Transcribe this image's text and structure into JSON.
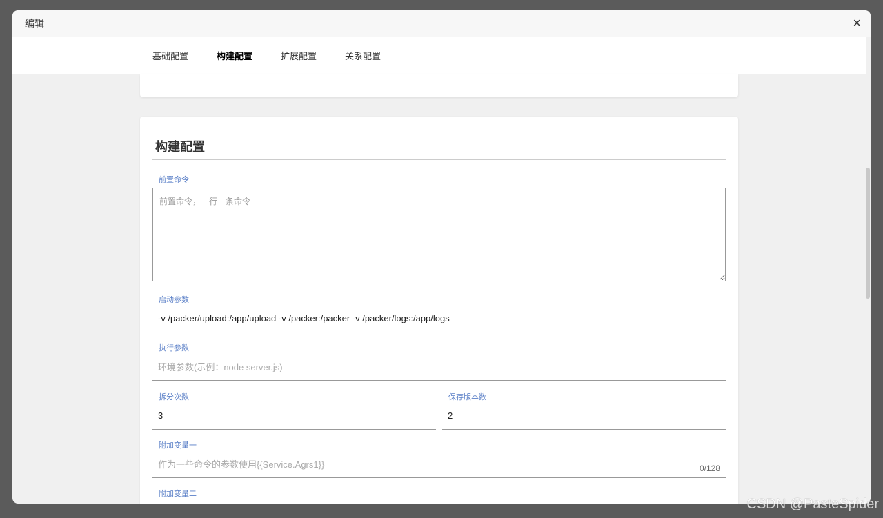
{
  "dialog": {
    "title": "编辑",
    "close_icon": "×"
  },
  "tabs": [
    "基础配置",
    "构建配置",
    "扩展配置",
    "关系配置"
  ],
  "section_title": "构建配置",
  "fields": {
    "pre_cmd": {
      "label": "前置命令",
      "placeholder": "前置命令，一行一条命令"
    },
    "start_args": {
      "label": "启动参数",
      "value": "-v /packer/upload:/app/upload -v /packer:/packer -v /packer/logs:/app/logs"
    },
    "exec_args": {
      "label": "执行参数",
      "placeholder": "环境参数(示例：node server.js)"
    },
    "split_count": {
      "label": "拆分次数",
      "value": "3"
    },
    "keep_versions": {
      "label": "保存版本数",
      "value": "2"
    },
    "extra_var1": {
      "label": "附加变量一",
      "placeholder": "作为一些命令的参数使用{{Service.Agrs1}}",
      "counter": "0/128"
    },
    "extra_var2": {
      "label": "附加变量二"
    }
  },
  "watermark": "CSDN @PasteSpider"
}
